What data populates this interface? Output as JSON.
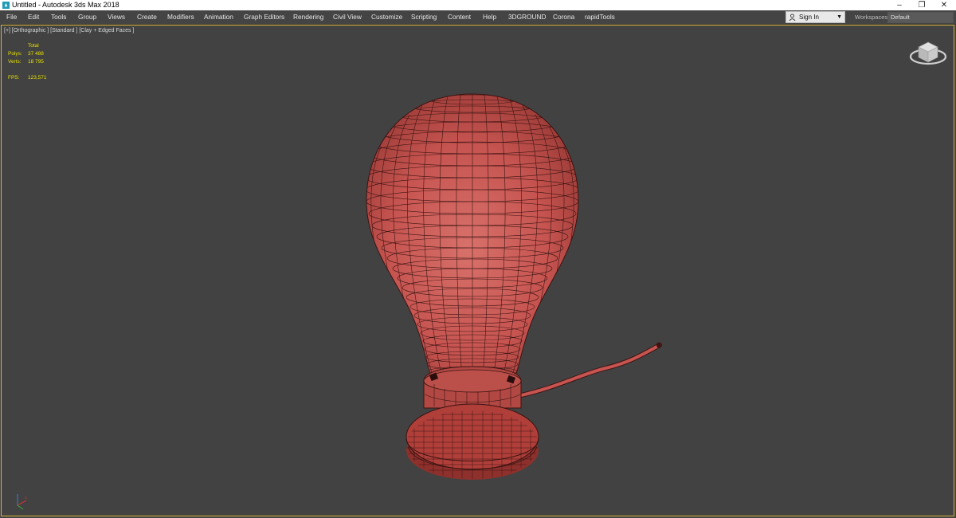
{
  "window": {
    "title": "Untitled - Autodesk 3ds Max 2018",
    "controls": [
      "–",
      "❐",
      "✕"
    ]
  },
  "menu": [
    "File",
    "Edit",
    "Tools",
    "Group",
    "Views",
    "Create",
    "Modifiers",
    "Animation",
    "Graph Editors",
    "Rendering",
    "Civil View",
    "Customize",
    "Scripting",
    "Content",
    "Help",
    "3DGROUND",
    "Corona",
    "rapidTools"
  ],
  "account": {
    "label": "Sign In"
  },
  "workspaces": {
    "label": "Workspaces:",
    "value": "Default"
  },
  "viewport": {
    "label": "[+] [Orthographic ] [Standard ] [Clay + Edged Faces ]",
    "stats": {
      "header": "Total",
      "polys_label": "Polys:",
      "polys": "37 488",
      "verts_label": "Verts:",
      "verts": "18 795",
      "fps_label": "FPS:",
      "fps": "123,571"
    }
  },
  "colors": {
    "model_fill": "#c65450",
    "model_wire": "#3c1412",
    "viewport_bg": "#424242",
    "active_border": "#d7b33a",
    "stats_text": "#e5e100"
  }
}
